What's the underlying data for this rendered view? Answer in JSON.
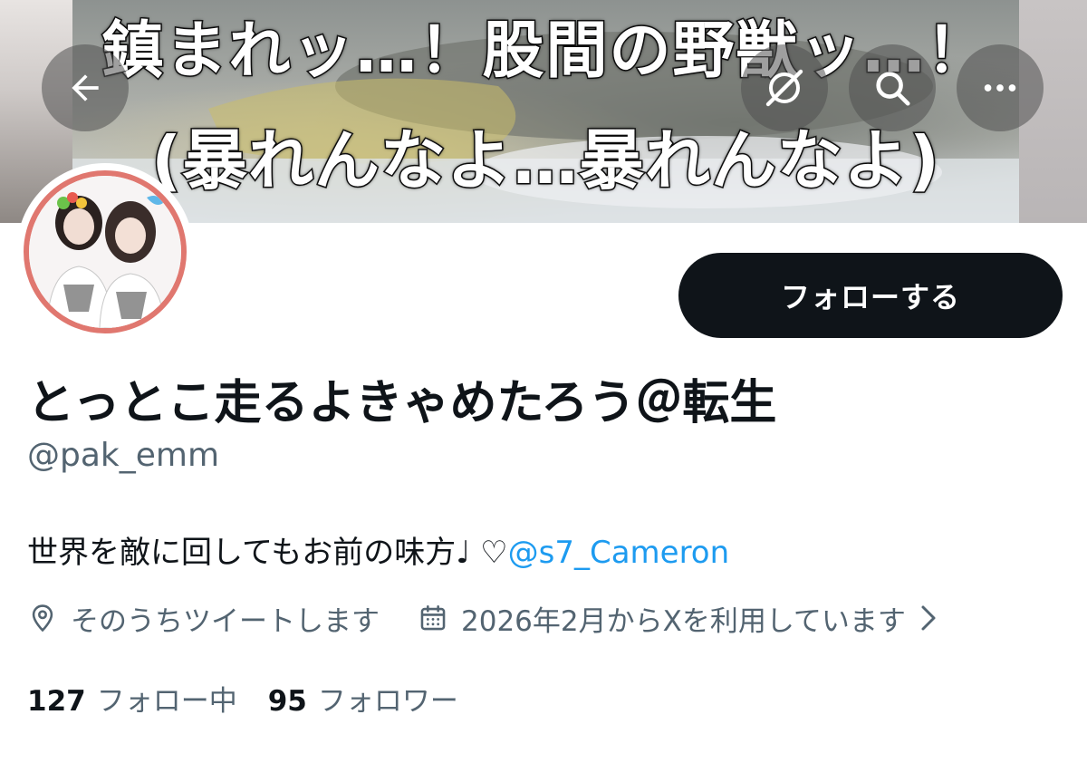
{
  "header": {
    "banner_caption_line1": "鎮まれッ…！股間の野獣ッ…！",
    "banner_caption_line2": "(暴れんなよ…暴れんなよ)",
    "icons": {
      "back": "arrow-left-icon",
      "grok": "grok-icon",
      "search": "search-icon",
      "more": "more-icon"
    }
  },
  "profile": {
    "display_name": "とっとこ走るよきゃめたろう＠転生",
    "handle": "@pak_emm",
    "bio_text": "世界を敵に回してもお前の味方♩ ♡",
    "bio_mention": "@s7_Cameron",
    "location": "そのうちツイートします",
    "joined": "2026年2月からXを利用しています",
    "avatar_ring_color": "#e0776f"
  },
  "actions": {
    "follow_label": "フォローする"
  },
  "stats": {
    "following_count": "127",
    "following_label": "フォロー中",
    "followers_count": "95",
    "followers_label": "フォロワー"
  },
  "colors": {
    "text_primary": "#0f1419",
    "text_secondary": "#536471",
    "link": "#1d9bf0",
    "button_bg": "#0f1419"
  }
}
